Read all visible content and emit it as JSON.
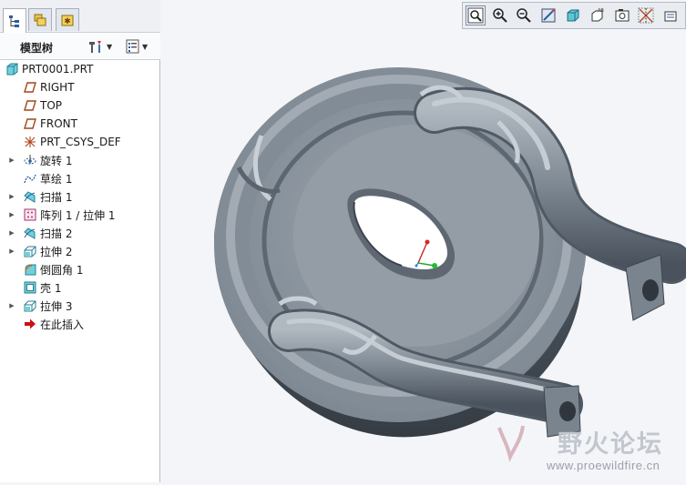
{
  "model_tree": {
    "title": "模型树",
    "items": [
      {
        "label": "PRT0001.PRT",
        "icon": "part-icon",
        "expandable": false
      },
      {
        "label": "RIGHT",
        "icon": "datum-plane-icon",
        "expandable": false
      },
      {
        "label": "TOP",
        "icon": "datum-plane-icon",
        "expandable": false
      },
      {
        "label": "FRONT",
        "icon": "datum-plane-icon",
        "expandable": false
      },
      {
        "label": "PRT_CSYS_DEF",
        "icon": "csys-icon",
        "expandable": false
      },
      {
        "label": "旋转 1",
        "icon": "revolve-icon",
        "expandable": true
      },
      {
        "label": "草绘 1",
        "icon": "sketch-icon",
        "expandable": false
      },
      {
        "label": "扫描 1",
        "icon": "sweep-icon",
        "expandable": true
      },
      {
        "label": "阵列 1 / 拉伸 1",
        "icon": "pattern-icon",
        "expandable": true
      },
      {
        "label": "扫描 2",
        "icon": "sweep-icon",
        "expandable": true
      },
      {
        "label": "拉伸 2",
        "icon": "extrude-icon",
        "expandable": true
      },
      {
        "label": "倒圆角 1",
        "icon": "round-icon",
        "expandable": false
      },
      {
        "label": "壳 1",
        "icon": "shell-icon",
        "expandable": false
      },
      {
        "label": "拉伸 3",
        "icon": "extrude-icon",
        "expandable": true
      },
      {
        "label": "在此插入",
        "icon": "insert-here-arrow-icon",
        "expandable": false
      }
    ]
  },
  "panel_tabs": [
    "model-tree-tab-icon",
    "folder-browser-tab-icon",
    "favorites-tab-icon"
  ],
  "view_toolbar": [
    "refit-icon",
    "zoom-in-icon",
    "zoom-out-icon",
    "repaint-icon",
    "shading-icon",
    "saved-views-icon",
    "layers-icon",
    "datum-display-icon",
    "spin-center-icon"
  ],
  "watermark": {
    "main": "野火论坛",
    "sub": "www.proewildfire.cn"
  },
  "colors": {
    "model_body": "#8a939d",
    "background": "#f4f5f8",
    "insert_arrow": "#cc1111"
  }
}
